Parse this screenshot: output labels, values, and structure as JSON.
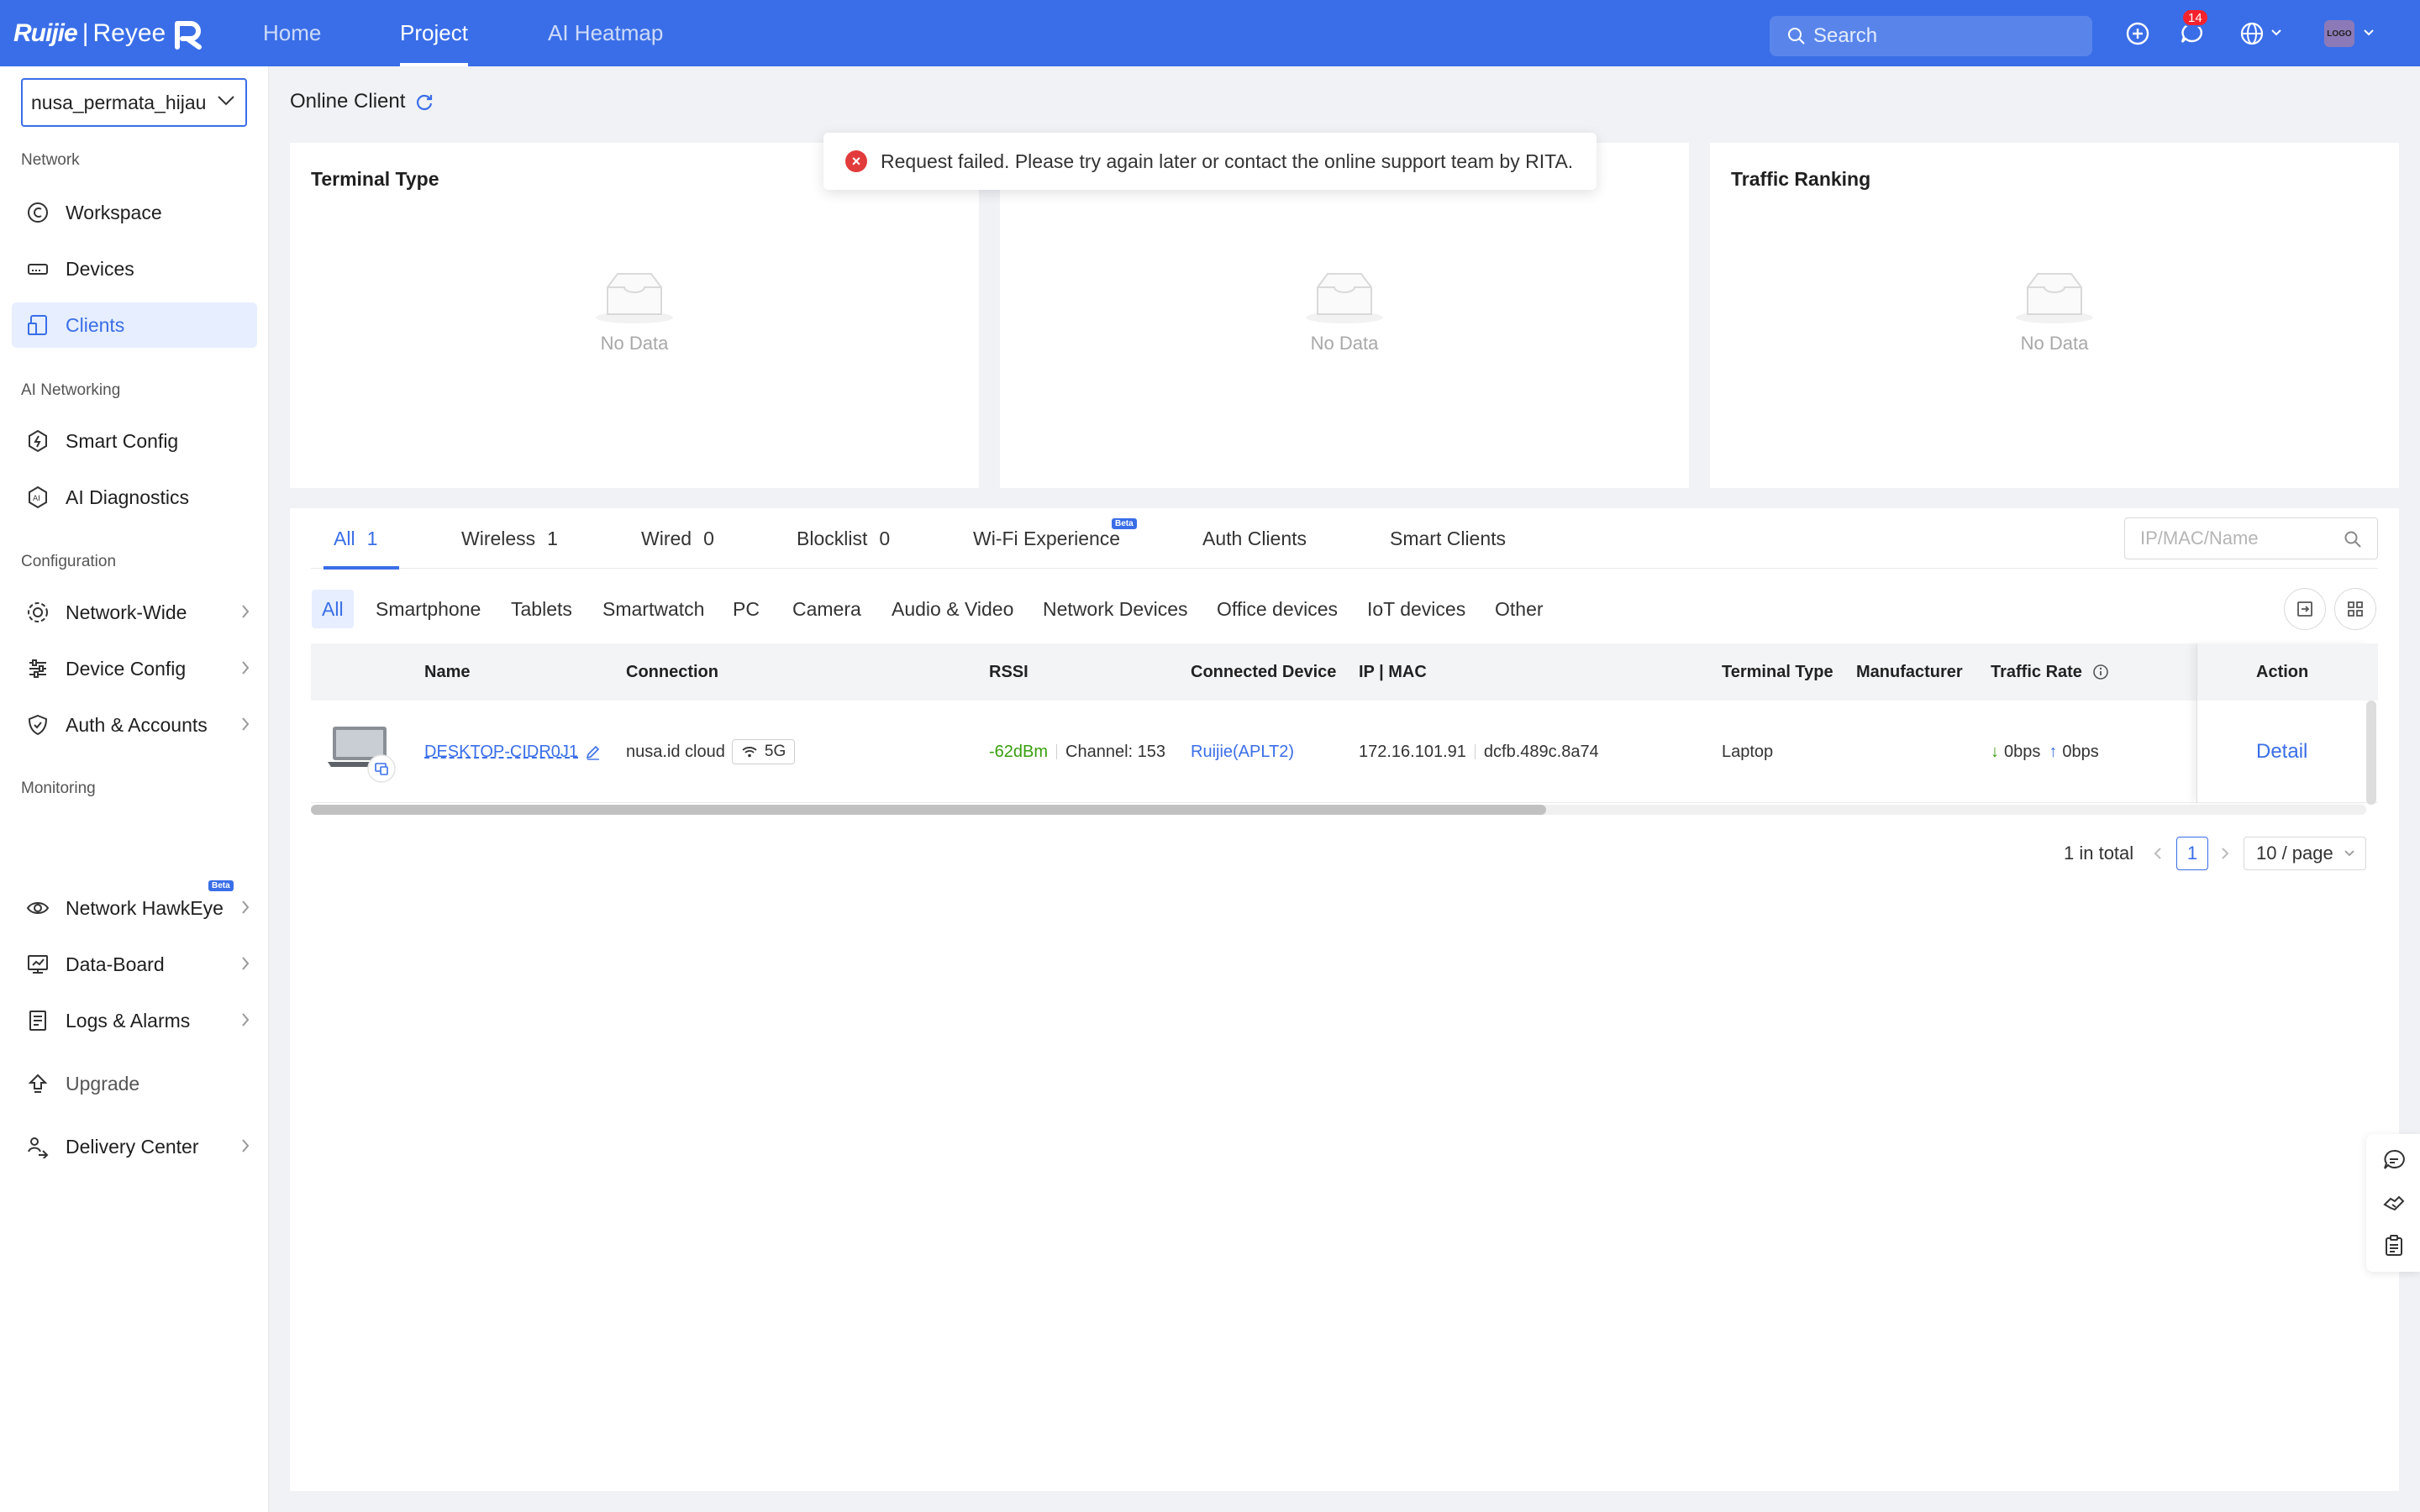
{
  "brand": {
    "ruijie": "Ruijie",
    "separator": "|",
    "reyee": "Reyee"
  },
  "nav": {
    "home": "Home",
    "project": "Project",
    "heatmap": "AI Heatmap"
  },
  "search": {
    "placeholder": "Search"
  },
  "notifications": {
    "count": "14"
  },
  "avatar": {
    "label": "LOGO"
  },
  "sidebar": {
    "project": "nusa_permata_hijau",
    "sections": {
      "network": "Network",
      "ai_networking": "AI Networking",
      "configuration": "Configuration",
      "monitoring": "Monitoring"
    },
    "items": {
      "workspace": "Workspace",
      "devices": "Devices",
      "clients": "Clients",
      "smart_config": "Smart Config",
      "ai_diagnostics": "AI Diagnostics",
      "network_wide": "Network-Wide",
      "device_config": "Device Config",
      "auth_accounts": "Auth & Accounts",
      "network_hawkeye": "Network HawkEye",
      "data_board": "Data-Board",
      "logs_alarms": "Logs & Alarms",
      "upgrade": "Upgrade",
      "delivery_center": "Delivery Center"
    },
    "beta": "Beta"
  },
  "page": {
    "title": "Online Client"
  },
  "cards": {
    "terminal_type": "Terminal Type",
    "traffic_ranking": "Traffic Ranking",
    "no_data": "No Data"
  },
  "toast": {
    "message": "Request failed. Please try again later or contact the online support team by RITA."
  },
  "tabs": [
    {
      "label": "All",
      "count": "1"
    },
    {
      "label": "Wireless",
      "count": "1"
    },
    {
      "label": "Wired",
      "count": "0"
    },
    {
      "label": "Blocklist",
      "count": "0"
    },
    {
      "label": "Wi-Fi Experience",
      "count": ""
    },
    {
      "label": "Auth Clients",
      "count": ""
    },
    {
      "label": "Smart Clients",
      "count": ""
    }
  ],
  "tab_search": {
    "placeholder": "IP/MAC/Name"
  },
  "filters": [
    "All",
    "Smartphone",
    "Tablets",
    "Smartwatch",
    "PC",
    "Camera",
    "Audio & Video",
    "Network Devices",
    "Office devices",
    "IoT devices",
    "Other"
  ],
  "table": {
    "headers": {
      "name": "Name",
      "connection": "Connection",
      "rssi": "RSSI",
      "connected_device": "Connected Device",
      "ip_mac": "IP | MAC",
      "terminal_type": "Terminal Type",
      "manufacturer": "Manufacturer",
      "traffic_rate": "Traffic Rate",
      "action": "Action"
    },
    "rows": [
      {
        "name": "DESKTOP-CIDR0J1",
        "ssid": "nusa.id cloud",
        "band": "5G",
        "rssi": "-62dBm",
        "channel": "Channel: 153",
        "connected_device": "Ruijie(APLT2)",
        "ip": "172.16.101.91",
        "mac": "dcfb.489c.8a74",
        "terminal_type": "Laptop",
        "manufacturer": "",
        "down": "0bps",
        "up": "0bps",
        "action": "Detail"
      }
    ]
  },
  "pagination": {
    "total": "1 in total",
    "current": "1",
    "page_size": "10 / page"
  },
  "colors": {
    "primary": "#3a6ee8",
    "error": "#e23b3b",
    "rssi_good": "#389e0d"
  }
}
